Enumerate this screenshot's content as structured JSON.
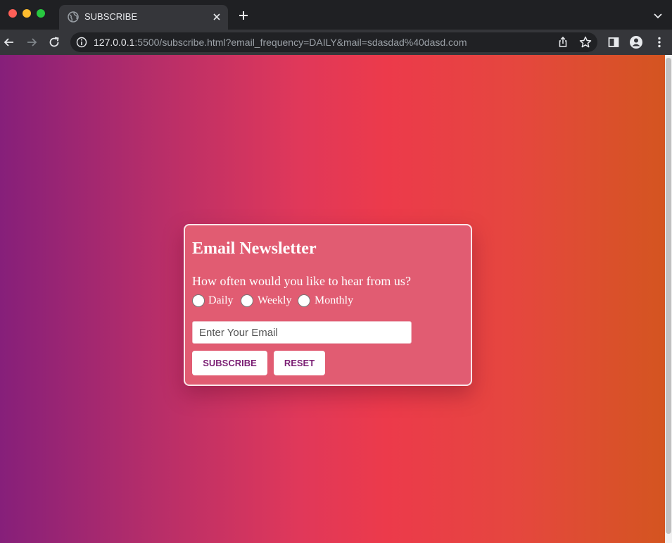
{
  "browser": {
    "tab": {
      "title": "SUBSCRIBE",
      "icon": "globe-icon"
    },
    "url": {
      "host": "127.0.0.1",
      "rest": ":5500/subscribe.html?email_frequency=DAILY&mail=sdasdad%40dasd.com"
    }
  },
  "form": {
    "title": "Email Newsletter",
    "question": "How often would you like to hear from us?",
    "options": [
      {
        "label": "Daily"
      },
      {
        "label": "Weekly"
      },
      {
        "label": "Monthly"
      }
    ],
    "email": {
      "placeholder": "Enter Your Email",
      "value": ""
    },
    "buttons": {
      "subscribe": "SUBSCRIBE",
      "reset": "RESET"
    }
  },
  "colors": {
    "gradient": [
      "#861f7a",
      "#e0385a",
      "#d45520"
    ],
    "card": "#e15c72",
    "button_text": "#7b1f74"
  }
}
